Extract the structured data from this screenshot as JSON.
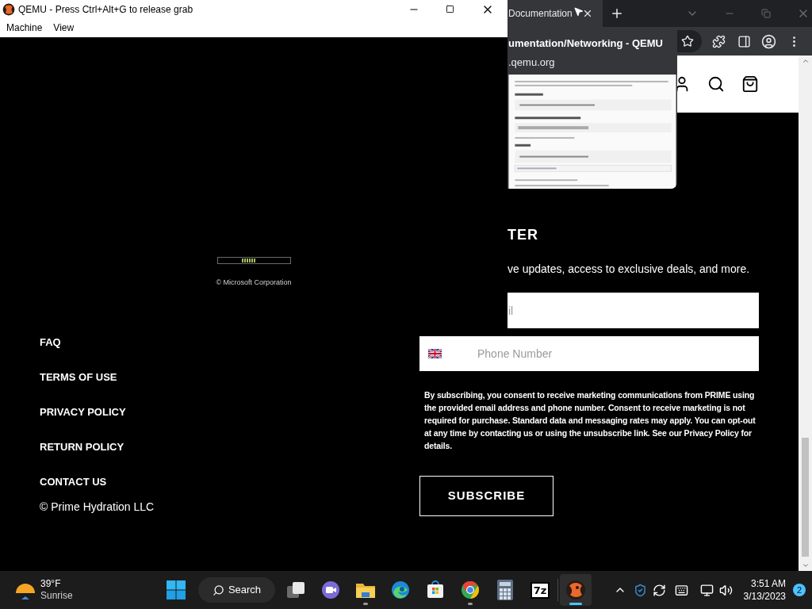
{
  "qemu_window": {
    "title": "QEMU - Press Ctrl+Alt+G to release grab",
    "menu": [
      "Machine",
      "View"
    ],
    "boot_copyright": "© Microsoft Corporation"
  },
  "browser": {
    "tabs": [
      {
        "label": "Documentation",
        "selected": true
      }
    ],
    "tab_preview": {
      "title": "umentation/Networking - QEMU",
      "url": ".qemu.org"
    },
    "newsletter": {
      "heading": "TER",
      "subtitle": "ve updates, access to exclusive deals, and more.",
      "email_placeholder": "il",
      "phone_placeholder": "Phone Number",
      "consent": "By subscribing, you consent to receive marketing communications from PRIME using the provided email address and phone number. Consent to receive marketing is not required for purchase. Standard data and messaging rates may apply. You can opt-out at any time by contacting us or using the unsubscribe link. See our Privacy Policy for details.",
      "button": "SUBSCRIBE"
    },
    "footer_links": [
      "FAQ",
      "TERMS OF USE",
      "PRIVACY POLICY",
      "RETURN POLICY",
      "CONTACT US"
    ],
    "copyright": "© Prime Hydration LLC"
  },
  "taskbar": {
    "weather": {
      "temperature": "39°F",
      "condition": "Sunrise"
    },
    "search": "Search",
    "apps": [
      {
        "kind": "task-view",
        "running": false,
        "selected": false
      },
      {
        "kind": "chat",
        "running": false,
        "selected": false
      },
      {
        "kind": "folder",
        "running": true,
        "selected": false
      },
      {
        "kind": "edge",
        "running": false,
        "selected": false
      },
      {
        "kind": "store",
        "running": false,
        "selected": false
      },
      {
        "kind": "chrome",
        "running": true,
        "selected": false
      },
      {
        "kind": "calculator",
        "running": false,
        "selected": false
      },
      {
        "kind": "archiver",
        "label": "7z",
        "running": false,
        "selected": false
      },
      {
        "kind": "qemu",
        "running": true,
        "selected": true
      }
    ],
    "clock": {
      "time": "3:51 AM",
      "date": "3/13/2023"
    },
    "notifications": "2"
  }
}
